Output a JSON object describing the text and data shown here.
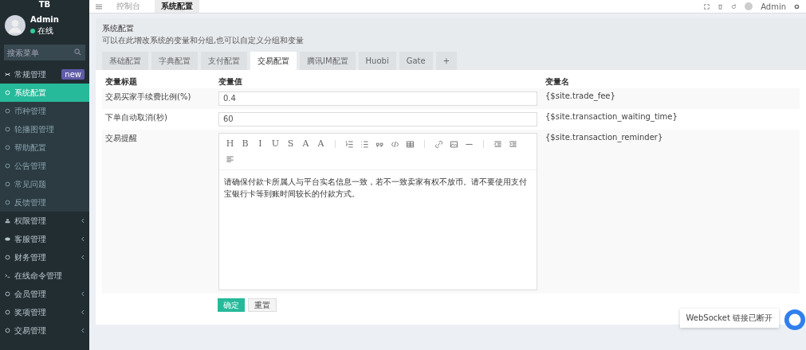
{
  "sidebar": {
    "logo": "TB",
    "user": {
      "name": "Admin",
      "status": "在线"
    },
    "search": {
      "placeholder": "搜索菜单"
    },
    "items": [
      {
        "label": "常规管理",
        "kind": "cog",
        "badge": "new",
        "expanded": true,
        "selected": false,
        "has_children": false,
        "children": [
          {
            "label": "系统配置",
            "selected": true
          },
          {
            "label": "币种管理",
            "selected": false
          },
          {
            "label": "轮播图管理",
            "selected": false
          },
          {
            "label": "帮助配置",
            "selected": false
          },
          {
            "label": "公告管理",
            "selected": false
          },
          {
            "label": "常见问题",
            "selected": false
          },
          {
            "label": "反馈管理",
            "selected": false
          }
        ]
      },
      {
        "label": "权限管理",
        "kind": "users",
        "expanded": false,
        "selected": false,
        "has_children": true
      },
      {
        "label": "客服管理",
        "kind": "chat",
        "expanded": false,
        "selected": false,
        "has_children": true
      },
      {
        "label": "财务管理",
        "kind": "circle",
        "expanded": false,
        "selected": false,
        "has_children": true
      },
      {
        "label": "在线命令管理",
        "kind": "terminal",
        "selected": false,
        "has_children": false
      },
      {
        "label": "会员管理",
        "kind": "circle",
        "expanded": false,
        "selected": false,
        "has_children": true
      },
      {
        "label": "奖项管理",
        "kind": "circle",
        "expanded": false,
        "selected": false,
        "has_children": true
      },
      {
        "label": "交易管理",
        "kind": "circle",
        "expanded": false,
        "selected": false,
        "has_children": true
      }
    ]
  },
  "topbar": {
    "tabs": [
      {
        "label": "控制台",
        "selected": false
      },
      {
        "label": "系统配置",
        "selected": true
      }
    ],
    "user": "Admin"
  },
  "panel": {
    "title": "系统配置",
    "description": "可以在此增改系统的变量和分组,也可以自定义分组和变量",
    "tabs": [
      {
        "label": "基础配置",
        "selected": false
      },
      {
        "label": "字典配置",
        "selected": false
      },
      {
        "label": "支付配置",
        "selected": false
      },
      {
        "label": "交易配置",
        "selected": true
      },
      {
        "label": "腾讯IM配置",
        "selected": false
      },
      {
        "label": "Huobi",
        "selected": false
      },
      {
        "label": "Gate",
        "selected": false
      },
      {
        "label": "+",
        "selected": false
      }
    ],
    "columns": [
      "变量标题",
      "变量值",
      "变量名"
    ],
    "rows": [
      {
        "kind": "input",
        "title": "交易买家手续费比例(%)",
        "value": "0.4",
        "name": "{$site.trade_fee}"
      },
      {
        "kind": "input",
        "title": "下单自动取消(秒)",
        "value": "60",
        "name": "{$site.transaction_waiting_time}"
      },
      {
        "kind": "editor",
        "title": "交易提醒",
        "value": "请确保付款卡所属人与平台实名信息一致，若不一致卖家有权不放币。请不要使用支付宝银行卡等到账时间较长的付款方式。",
        "name": "{$site.transaction_reminder}"
      }
    ],
    "toolbar": [
      {
        "kind": "letter",
        "label": "H"
      },
      {
        "kind": "letter",
        "label": "B"
      },
      {
        "kind": "letter",
        "label": "I"
      },
      {
        "kind": "letter",
        "label": "U"
      },
      {
        "kind": "letter",
        "label": "S"
      },
      {
        "kind": "letter",
        "label": "A"
      },
      {
        "kind": "letter",
        "label": "A"
      },
      {
        "kind": "sep"
      },
      {
        "kind": "ol"
      },
      {
        "kind": "ul"
      },
      {
        "kind": "quote"
      },
      {
        "kind": "code"
      },
      {
        "kind": "table"
      },
      {
        "kind": "sep"
      },
      {
        "kind": "link"
      },
      {
        "kind": "image"
      },
      {
        "kind": "hr"
      },
      {
        "kind": "sep"
      },
      {
        "kind": "outdent"
      },
      {
        "kind": "indent"
      },
      {
        "kind": "align"
      }
    ],
    "buttons": [
      {
        "kind": "primary",
        "label": "确定"
      },
      {
        "kind": "default",
        "label": "重置"
      }
    ]
  },
  "toast": "WebSocket 链接已断开"
}
